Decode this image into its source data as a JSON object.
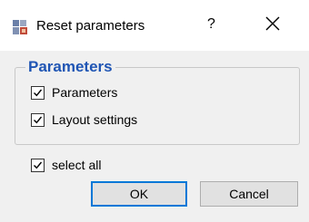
{
  "window": {
    "title": "Reset parameters",
    "help_label": "?",
    "app_icon": "reset-app-icon",
    "close_icon": "close-icon"
  },
  "group": {
    "title": "Parameters",
    "items": [
      {
        "label": "Parameters",
        "checked": true
      },
      {
        "label": "Layout settings",
        "checked": true
      }
    ]
  },
  "select_all": {
    "label": "select all",
    "checked": true
  },
  "buttons": {
    "ok": "OK",
    "cancel": "Cancel"
  },
  "colors": {
    "accent": "#1f55b4",
    "focus_border": "#0078d7"
  }
}
